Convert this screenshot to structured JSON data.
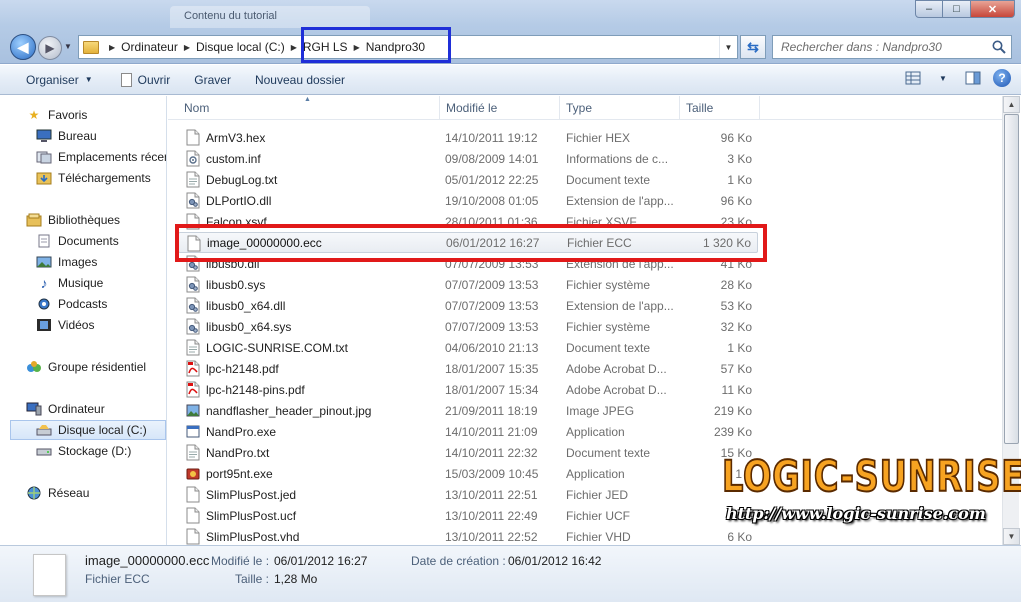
{
  "window": {
    "ghost_tab_label": "Contenu du tutorial",
    "controls": {
      "minimize": "–",
      "maximize": "□",
      "close": "✕"
    }
  },
  "address": {
    "crumbs": [
      "Ordinateur",
      "Disque local (C:)",
      "RGH LS",
      "Nandpro30"
    ]
  },
  "search": {
    "placeholder": "Rechercher dans : Nandpro30"
  },
  "toolbar": {
    "organize": "Organiser",
    "open": "Ouvrir",
    "burn": "Graver",
    "new_folder": "Nouveau dossier"
  },
  "nav": {
    "favorites": "Favoris",
    "desktop": "Bureau",
    "recent": "Emplacements récents",
    "downloads": "Téléchargements",
    "libraries": "Bibliothèques",
    "documents": "Documents",
    "images": "Images",
    "music": "Musique",
    "podcasts": "Podcasts",
    "videos": "Vidéos",
    "homegroup": "Groupe résidentiel",
    "computer": "Ordinateur",
    "local_disk": "Disque local (C:)",
    "storage": "Stockage (D:)",
    "network": "Réseau"
  },
  "columns": {
    "name": "Nom",
    "modified": "Modifié le",
    "type": "Type",
    "size": "Taille"
  },
  "files": [
    {
      "name": "ArmV3.hex",
      "modified": "14/10/2011 19:12",
      "type": "Fichier HEX",
      "size": "96 Ko",
      "icon": "file-icon"
    },
    {
      "name": "custom.inf",
      "modified": "09/08/2009 14:01",
      "type": "Informations de c...",
      "size": "3 Ko",
      "icon": "settings-file-icon"
    },
    {
      "name": "DebugLog.txt",
      "modified": "05/01/2012 22:25",
      "type": "Document texte",
      "size": "1 Ko",
      "icon": "text-file-icon"
    },
    {
      "name": "DLPortIO.dll",
      "modified": "19/10/2008 01:05",
      "type": "Extension de l'app...",
      "size": "96 Ko",
      "icon": "dll-file-icon"
    },
    {
      "name": "Falcon.xsvf",
      "modified": "28/10/2011 01:36",
      "type": "Fichier XSVF",
      "size": "23 Ko",
      "icon": "file-icon"
    },
    {
      "name": "image_00000000.ecc",
      "modified": "06/01/2012 16:27",
      "type": "Fichier ECC",
      "size": "1 320 Ko",
      "icon": "file-icon"
    },
    {
      "name": "libusb0.dll",
      "modified": "07/07/2009 13:53",
      "type": "Extension de l'app...",
      "size": "41 Ko",
      "icon": "dll-file-icon"
    },
    {
      "name": "libusb0.sys",
      "modified": "07/07/2009 13:53",
      "type": "Fichier système",
      "size": "28 Ko",
      "icon": "dll-file-icon"
    },
    {
      "name": "libusb0_x64.dll",
      "modified": "07/07/2009 13:53",
      "type": "Extension de l'app...",
      "size": "53 Ko",
      "icon": "dll-file-icon"
    },
    {
      "name": "libusb0_x64.sys",
      "modified": "07/07/2009 13:53",
      "type": "Fichier système",
      "size": "32 Ko",
      "icon": "dll-file-icon"
    },
    {
      "name": "LOGIC-SUNRISE.COM.txt",
      "modified": "04/06/2010 21:13",
      "type": "Document texte",
      "size": "1 Ko",
      "icon": "text-file-icon"
    },
    {
      "name": "lpc-h2148.pdf",
      "modified": "18/01/2007 15:35",
      "type": "Adobe Acrobat D...",
      "size": "57 Ko",
      "icon": "pdf-file-icon"
    },
    {
      "name": "lpc-h2148-pins.pdf",
      "modified": "18/01/2007 15:34",
      "type": "Adobe Acrobat D...",
      "size": "11 Ko",
      "icon": "pdf-file-icon"
    },
    {
      "name": "nandflasher_header_pinout.jpg",
      "modified": "21/09/2011 18:19",
      "type": "Image JPEG",
      "size": "219 Ko",
      "icon": "image-file-icon"
    },
    {
      "name": "NandPro.exe",
      "modified": "14/10/2011 21:09",
      "type": "Application",
      "size": "239 Ko",
      "icon": "exe-file-icon"
    },
    {
      "name": "NandPro.txt",
      "modified": "14/10/2011 22:32",
      "type": "Document texte",
      "size": "15 Ko",
      "icon": "text-file-icon"
    },
    {
      "name": "port95nt.exe",
      "modified": "15/03/2009 10:45",
      "type": "Application",
      "size": "1 6",
      "icon": "installer-file-icon"
    },
    {
      "name": "SlimPlusPost.jed",
      "modified": "13/10/2011 22:51",
      "type": "Fichier JED",
      "size": "",
      "icon": "file-icon"
    },
    {
      "name": "SlimPlusPost.ucf",
      "modified": "13/10/2011 22:49",
      "type": "Fichier UCF",
      "size": "",
      "icon": "file-icon"
    },
    {
      "name": "SlimPlusPost.vhd",
      "modified": "13/10/2011 22:52",
      "type": "Fichier VHD",
      "size": "6 Ko",
      "icon": "file-icon"
    }
  ],
  "selected_index": 5,
  "details": {
    "name": "image_00000000.ecc",
    "type": "Fichier ECC",
    "modified_label": "Modifié le :",
    "modified_value": "06/01/2012 16:27",
    "created_label": "Date de création :",
    "created_value": "06/01/2012 16:42",
    "size_label": "Taille :",
    "size_value": "1,28 Mo"
  },
  "watermark": {
    "logo": "LOGIC-SUNRISE",
    "url": "http://www.logic-sunrise.com"
  },
  "colors": {
    "red_annotation": "#e11919",
    "blue_annotation": "#1f2fd8",
    "watermark_orange": "#f7a321"
  }
}
